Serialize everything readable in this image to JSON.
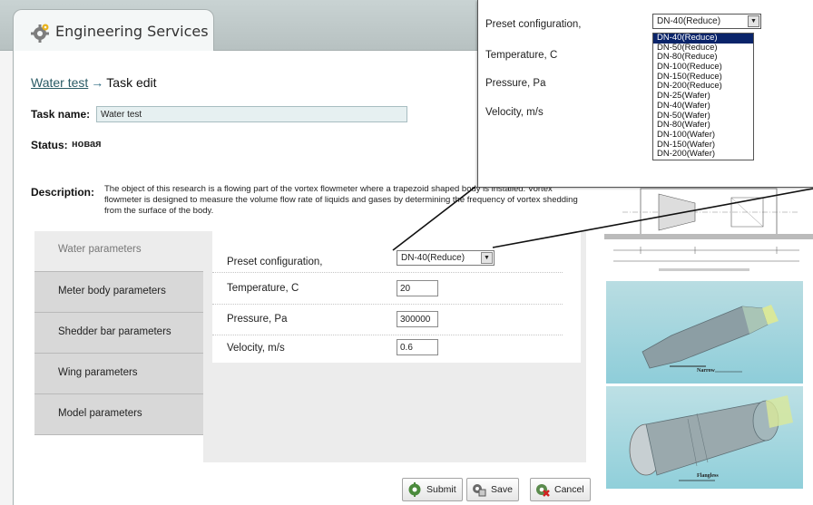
{
  "app": {
    "title": "Engineering Services"
  },
  "breadcrumb": {
    "parent": "Water test",
    "arrow": "→",
    "current": "Task edit"
  },
  "task": {
    "name_label": "Task name:",
    "name_value": "Water test",
    "status_label": "Status:",
    "status_value": "новая",
    "description_label": "Description:",
    "description_text": "The object of this research is a flowing part of the vortex flowmeter where a trapezoid shaped body is installed. Vortex flowmeter is designed to measure the volume flow rate of liquids and gases by determining the frequency of vortex shedding from the surface of the body."
  },
  "nav": {
    "items": [
      {
        "label": "Water parameters",
        "active": true
      },
      {
        "label": "Meter body parameters",
        "active": false
      },
      {
        "label": "Shedder bar parameters",
        "active": false
      },
      {
        "label": "Wing parameters",
        "active": false
      },
      {
        "label": "Model parameters",
        "active": false
      }
    ]
  },
  "form": {
    "preset_label": "Preset configuration,",
    "preset_value": "DN-40(Reduce)",
    "temperature_label": "Temperature, C",
    "temperature_value": "20",
    "pressure_label": "Pressure, Pa",
    "pressure_value": "300000",
    "velocity_label": "Velocity, m/s",
    "velocity_value": "0.6"
  },
  "buttons": {
    "submit": "Submit",
    "save": "Save",
    "cancel": "Cancel"
  },
  "zoom": {
    "preset_label": "Preset configuration,",
    "preset_value": "DN-40(Reduce)",
    "temperature_label": "Temperature, C",
    "pressure_label": "Pressure, Pa",
    "velocity_label": "Velocity, m/s",
    "options": [
      "DN-40(Reduce)",
      "DN-50(Reduce)",
      "DN-80(Reduce)",
      "DN-100(Reduce)",
      "DN-150(Reduce)",
      "DN-200(Reduce)",
      "DN-25(Wafer)",
      "DN-40(Wafer)",
      "DN-50(Wafer)",
      "DN-80(Wafer)",
      "DN-100(Wafer)",
      "DN-150(Wafer)",
      "DN-200(Wafer)"
    ],
    "selected_option": "DN-40(Reduce)"
  },
  "images": {
    "render1_caption": "Narrow",
    "render2_caption": "Flangless"
  },
  "colors": {
    "header": "#c4cece",
    "link": "#2a5b66",
    "nav_inactive": "#d8d8d8",
    "dropdown_selected": "#0a246a"
  }
}
